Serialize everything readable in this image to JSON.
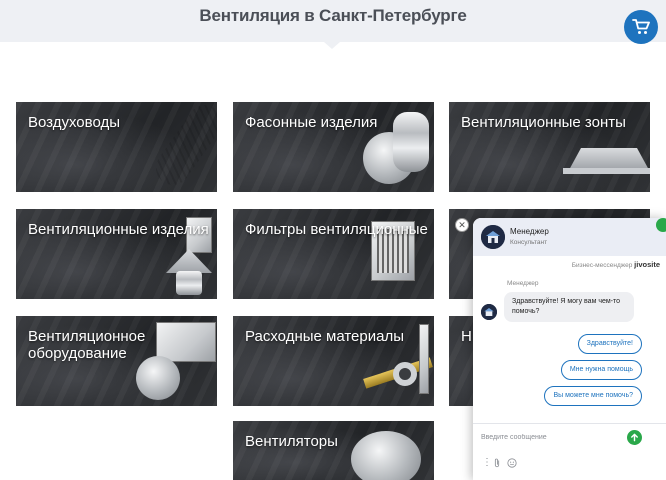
{
  "header": {
    "title": "Вентиляция в Санкт-Петербурге"
  },
  "cart": {
    "icon": "cart-icon"
  },
  "categories": [
    {
      "label": "Воздуховоды"
    },
    {
      "label": "Фасонные изделия"
    },
    {
      "label": "Вентиляционные зонты"
    },
    {
      "label": "Вентиляционные изделия"
    },
    {
      "label": "Фильтры вентиляционные"
    },
    {
      "label": "Вентиляционное оборудование"
    },
    {
      "label": "Расходные материалы"
    },
    {
      "label": "Вентиляторы"
    },
    {
      "label": "Н"
    }
  ],
  "chat": {
    "agent_name": "Менеджер",
    "agent_role": "Консультант",
    "brand_prefix": "Бизнес-мессенджер",
    "brand_name": "jivosite",
    "sender_label": "Менеджер",
    "message": "Здравствуйте! Я могу вам чем-то помочь?",
    "quick_replies": [
      "Здравствуйте!",
      "Мне нужна помощь",
      "Вы можете мне помочь?"
    ],
    "input_placeholder": "Введите сообщение",
    "close_label": "✕",
    "send_icon": "send-arrow-icon"
  },
  "colors": {
    "accent": "#1e73be",
    "online": "#2aa84a",
    "card_bg": "#2b2d30"
  }
}
